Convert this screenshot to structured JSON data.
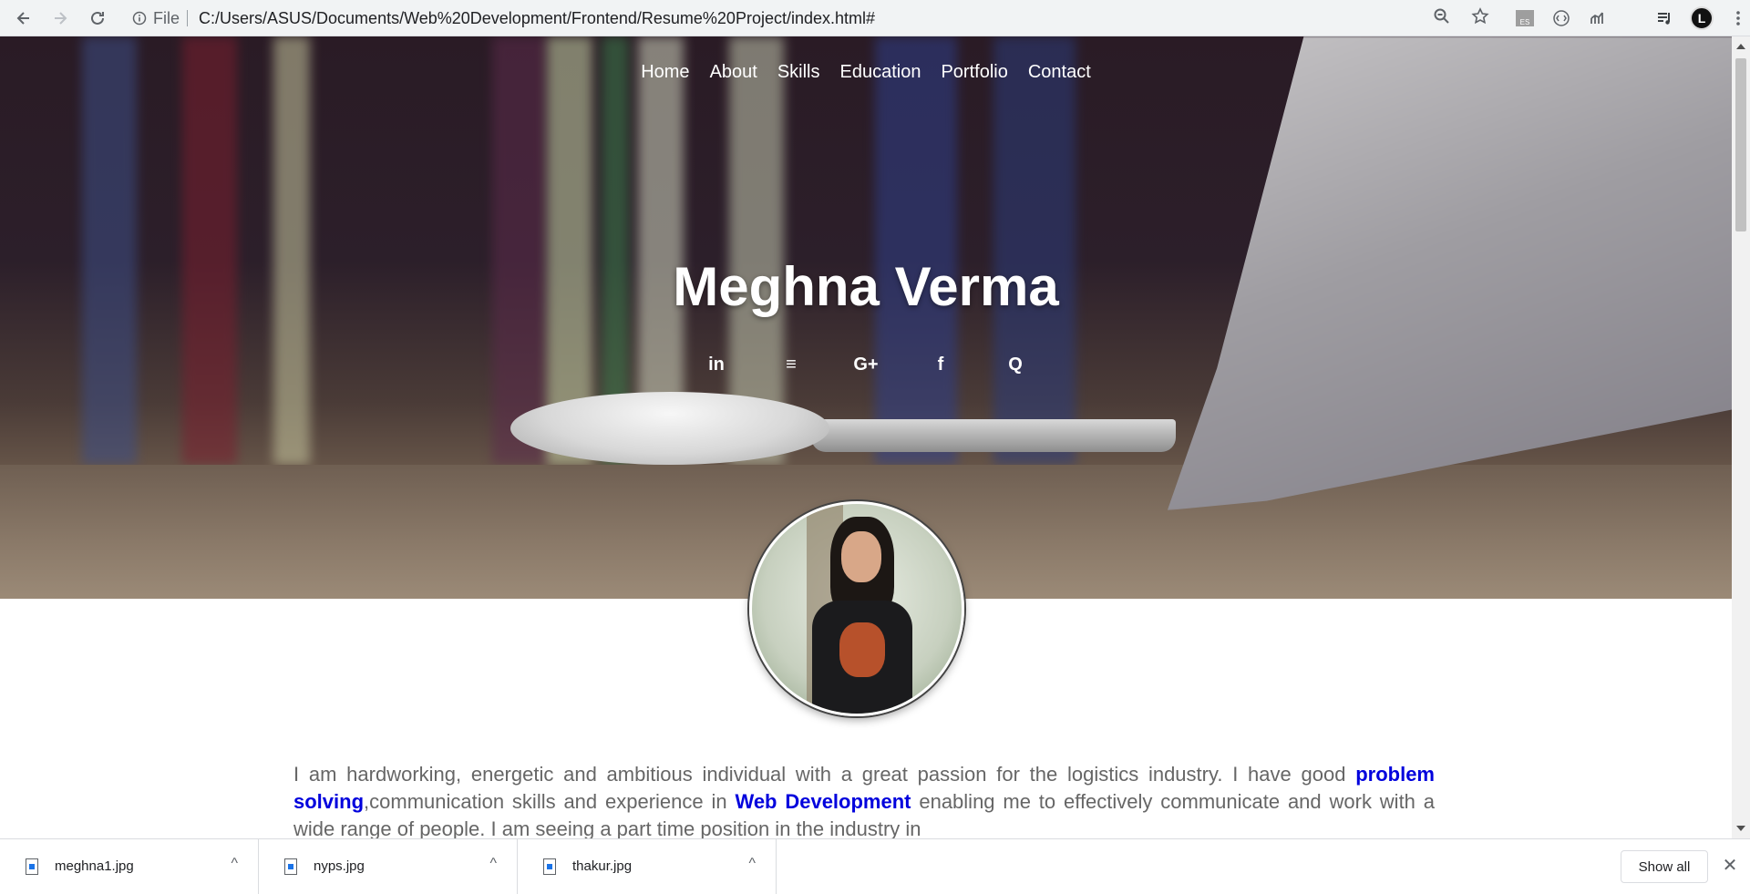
{
  "browser": {
    "scheme_label": "File",
    "url": "C:/Users/ASUS/Documents/Web%20Development/Frontend/Resume%20Project/index.html#",
    "icons": [
      "back-icon",
      "forward-icon",
      "reload-icon",
      "info-icon",
      "zoom-icon",
      "star-icon",
      "extension-es-icon",
      "extension-circle-icon",
      "extension-chart-icon",
      "media-icon",
      "profile-icon",
      "menu-icon"
    ],
    "extension_es_label": "ES",
    "profile_letter": "L"
  },
  "site": {
    "nav": [
      "Home",
      "About",
      "Skills",
      "Education",
      "Portfolio",
      "Contact"
    ],
    "name": "Meghna Verma",
    "socials": [
      {
        "icon": "linkedin-icon",
        "glyph": "in"
      },
      {
        "icon": "stackoverflow-icon",
        "glyph": "≡"
      },
      {
        "icon": "google-plus-icon",
        "glyph": "G+"
      },
      {
        "icon": "facebook-icon",
        "glyph": "f"
      },
      {
        "icon": "quora-icon",
        "glyph": "Q"
      }
    ],
    "about": {
      "part1": "I am hardworking, energetic and ambitious individual with a great passion for the logistics industry. I have good ",
      "highlight1": "problem solving",
      "part2": ",communication skills and experience in ",
      "highlight2": "Web Development",
      "part3": " enabling me to effectively communicate and work with a wide range of people. I am seeing a part time position in the industry in"
    },
    "accent_color": "#0000dd"
  },
  "downloads": {
    "items": [
      {
        "name": "meghna1.jpg"
      },
      {
        "name": "nyps.jpg"
      },
      {
        "name": "thakur.jpg"
      }
    ],
    "show_all_label": "Show all",
    "close_glyph": "✕",
    "caret_glyph": "^"
  }
}
